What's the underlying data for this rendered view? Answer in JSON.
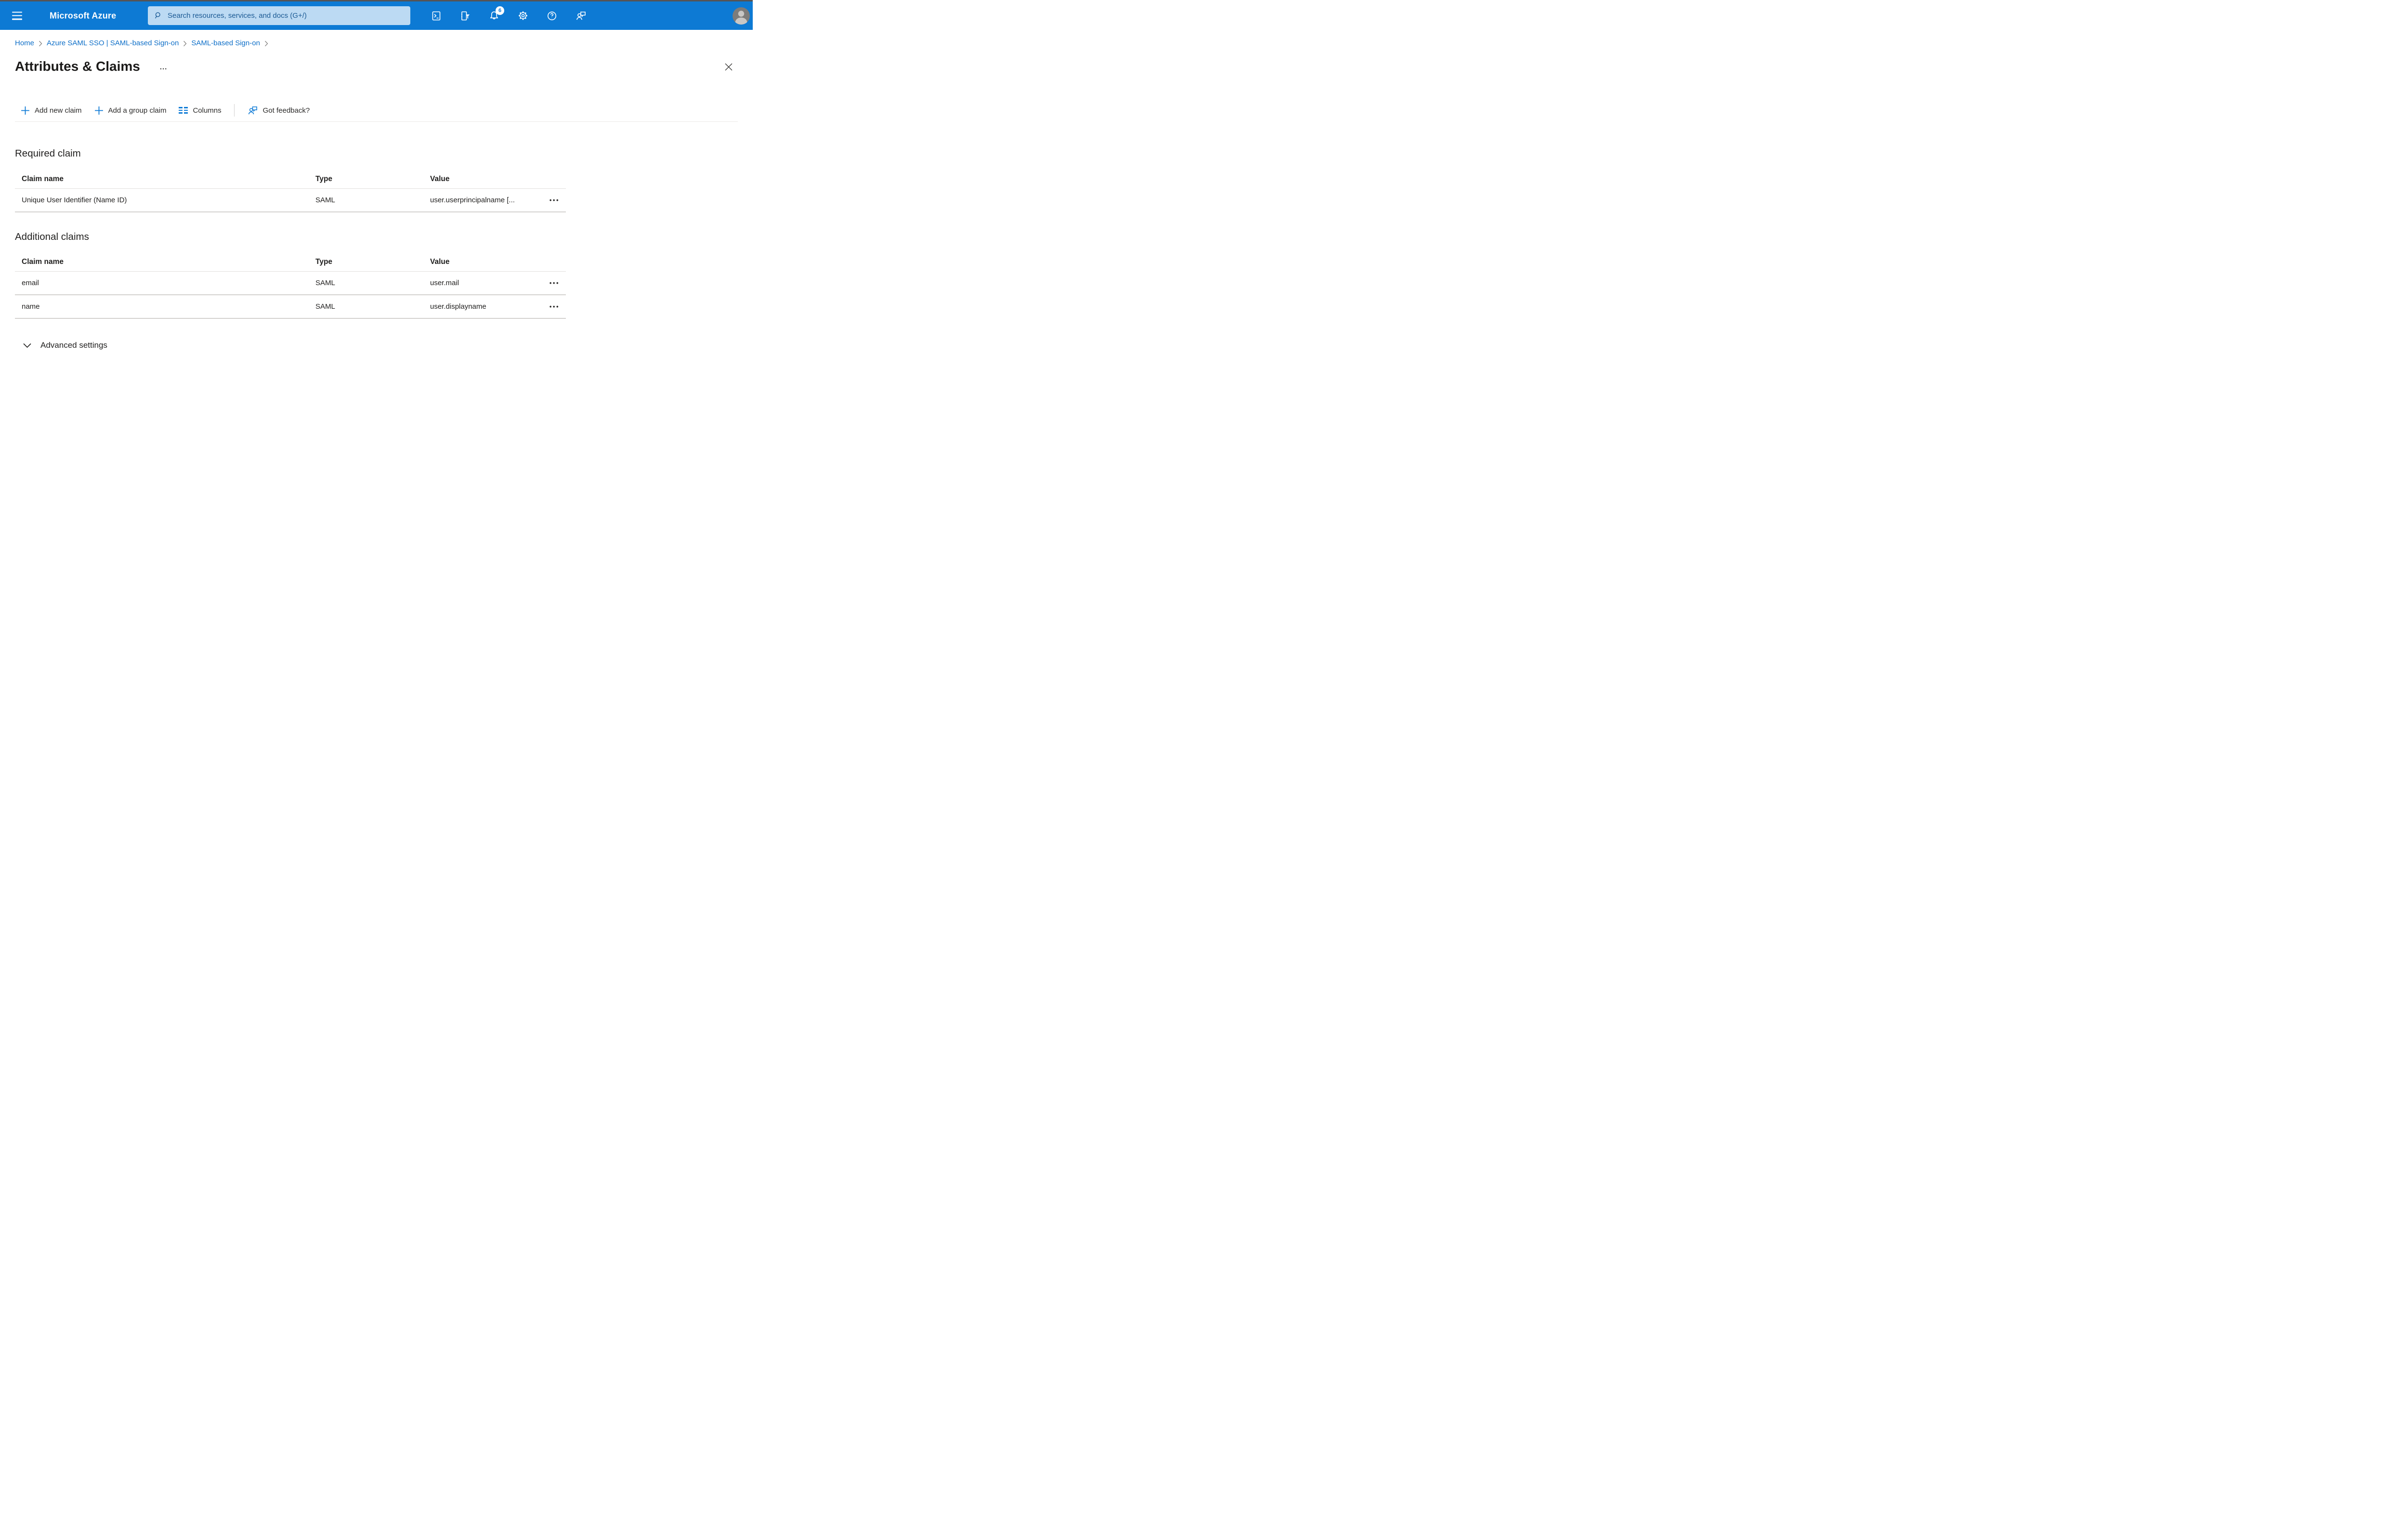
{
  "topbar": {
    "product": "Microsoft Azure",
    "search_placeholder": "Search resources, services, and docs (G+/)",
    "search_value": "",
    "notification_count": "6",
    "icons": {
      "menu": "hamburger",
      "search": "magnifier",
      "cloud_shell": "terminal",
      "directory_filter": "list-funnel",
      "notifications": "bell",
      "settings": "gear",
      "help": "question-circle",
      "feedback": "person-speech-bubble",
      "account": "avatar-silhouette"
    }
  },
  "breadcrumb": {
    "separator": ">",
    "items": [
      {
        "label": "Home"
      },
      {
        "label": "Azure SAML SSO | SAML-based Sign-on"
      },
      {
        "label": "SAML-based Sign-on"
      }
    ]
  },
  "page": {
    "title": "Attributes & Claims",
    "more": "...",
    "close": "✕"
  },
  "toolbar": {
    "add_new_claim": "Add new claim",
    "add_group_claim": "Add a group claim",
    "columns": "Columns",
    "got_feedback": "Got feedback?"
  },
  "labels": {
    "row_menu": "•••"
  },
  "required_claim": {
    "heading": "Required claim",
    "columns": [
      "Claim name",
      "Type",
      "Value"
    ],
    "rows": [
      {
        "name": "Unique User Identifier (Name ID)",
        "type": "SAML",
        "value": "user.userprincipalname [..."
      }
    ]
  },
  "additional_claims": {
    "heading": "Additional claims",
    "columns": [
      "Claim name",
      "Type",
      "Value"
    ],
    "rows": [
      {
        "name": "email",
        "type": "SAML",
        "value": "user.mail"
      },
      {
        "name": "name",
        "type": "SAML",
        "value": "user.displayname"
      }
    ]
  },
  "advanced_settings": {
    "label": "Advanced settings"
  },
  "colors": {
    "topbar": "#0d7ad4",
    "accent": "#0f7bd6",
    "link": "#0e6fc8",
    "search_fill": "#bcdaf3",
    "badge_bg": "#ffffff",
    "badge_text": "#0d7ad4",
    "text": "#201f1e",
    "divider": "#d4d2d0"
  }
}
